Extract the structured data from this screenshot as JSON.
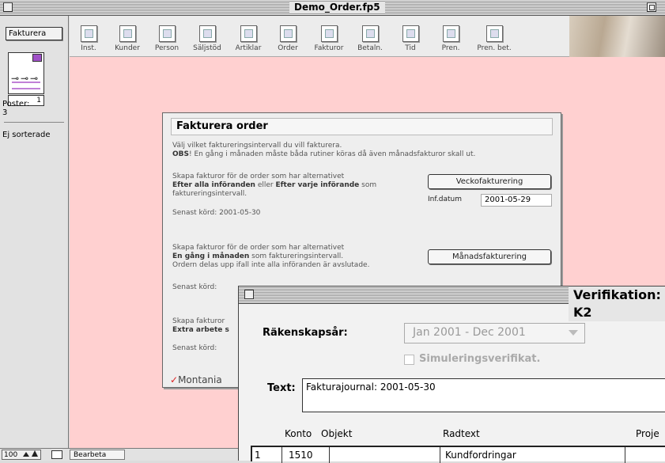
{
  "window": {
    "title": "Demo_Order.fp5"
  },
  "left_panel": {
    "layout_button": "Fakturera",
    "record_number": "1",
    "records_label": "Poster:",
    "records_count": "3",
    "sort_status": "Ej sorterade"
  },
  "toolbar": {
    "items": [
      "Inst.",
      "Kunder",
      "Person",
      "Säljstöd",
      "Artiklar",
      "Order",
      "Fakturor",
      "Betaln.",
      "Tid",
      "Pren.",
      "Pren. bet."
    ]
  },
  "status_bar": {
    "zoom": "100",
    "mode": "Bearbeta"
  },
  "dialog": {
    "title": "Fakturera order",
    "intro_line1": "Välj vilket faktureringsintervall du vill fakturera.",
    "intro_obs": "OBS",
    "intro_line2": "! En gång i månaden måste båda rutiner köras då även månadsfakturor skall ut.",
    "s1_line1": "Skapa fakturor för de order som har alternativet",
    "s1_bold1": "Efter alla införanden",
    "s1_mid": " eller ",
    "s1_bold2": "Efter varje införande",
    "s1_tail": " som",
    "s1_line3": "faktureringsintervall.",
    "weekly_button": "Veckofakturering",
    "inf_datum_label": "Inf.datum",
    "inf_datum_value": "2001-05-29",
    "s1_last_run": "Senast körd: 2001-05-30",
    "s2_line1": "Skapa fakturor för de order som har alternativet",
    "s2_bold": "En gång i månaden",
    "s2_tail": " som faktureringsintervall.",
    "s2_line3": "Ordern delas upp ifall inte alla införanden är avslutade.",
    "monthly_button": "Månadsfakturering",
    "s2_last_run": "Senast körd:",
    "s3_line1": "Skapa fakturor",
    "s3_bold": "Extra arbete s",
    "s3_last_run": "Senast körd:",
    "logo_text": "Montania"
  },
  "verifikation": {
    "title": "Verifikation: K2",
    "rakenskapsar_label": "Räkenskapsår:",
    "rakenskapsar_value": "Jan 2001 - Dec 2001",
    "simulering_label": "Simuleringsverifikat.",
    "text_label": "Text:",
    "text_value": "Fakturajournal: 2001-05-30",
    "columns": {
      "konto": "Konto",
      "objekt": "Objekt",
      "radtext": "Radtext",
      "projekt": "Proje"
    },
    "row": {
      "num": "1",
      "konto": "1510",
      "objekt": "",
      "radtext": "Kundfordringar"
    }
  }
}
